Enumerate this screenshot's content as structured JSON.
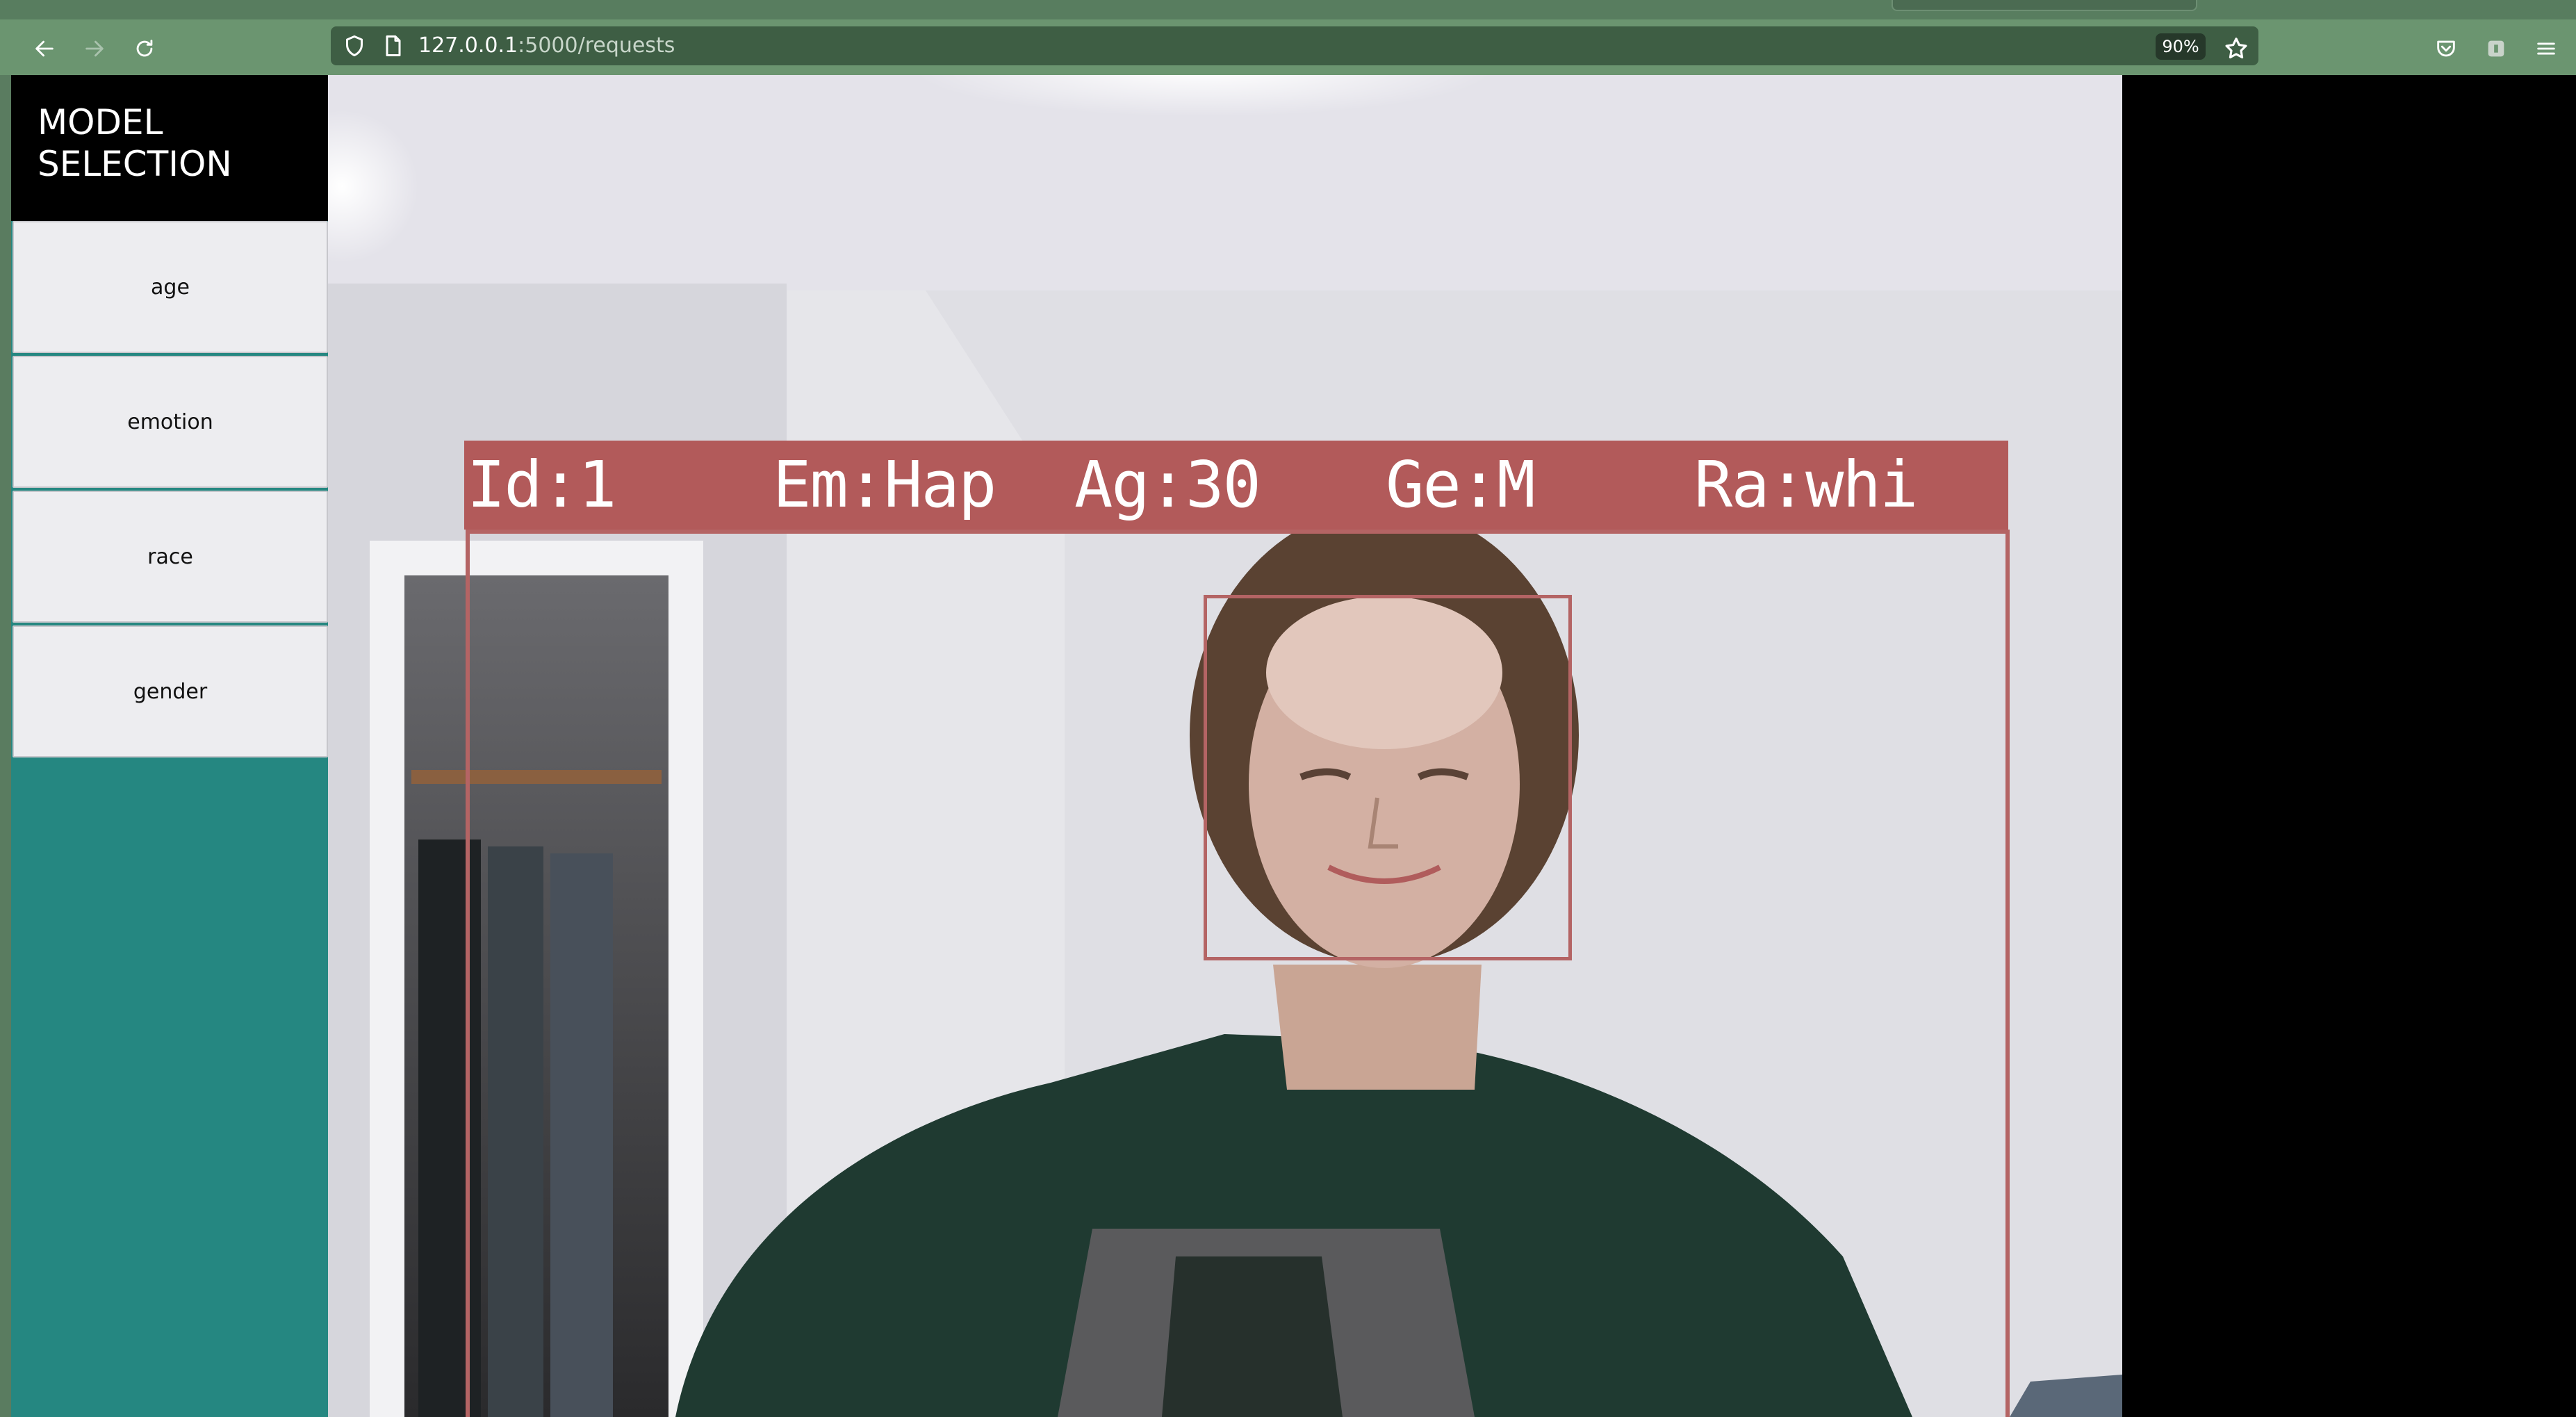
{
  "browser": {
    "url_host": "127.0.0.1",
    "url_path": ":5000/requests",
    "zoom": "90%",
    "icons": [
      "back-icon",
      "forward-icon",
      "reload-icon",
      "shield-icon",
      "page-icon",
      "star-icon",
      "pocket-icon",
      "extension-icon",
      "menu-icon"
    ]
  },
  "sidebar": {
    "title": "MODEL\nSELECTION",
    "buttons": [
      {
        "label": "age"
      },
      {
        "label": "emotion"
      },
      {
        "label": "race"
      },
      {
        "label": "gender"
      }
    ]
  },
  "detection": {
    "id": "Id:1",
    "emotion": "Em:Hap",
    "age": "Ag:30",
    "gender": "Ge:M",
    "race": "Ra:whi"
  },
  "colors": {
    "sidebar_bg": "#258781",
    "toolbar_bg": "#6b9570",
    "box": "#b25a5a"
  }
}
